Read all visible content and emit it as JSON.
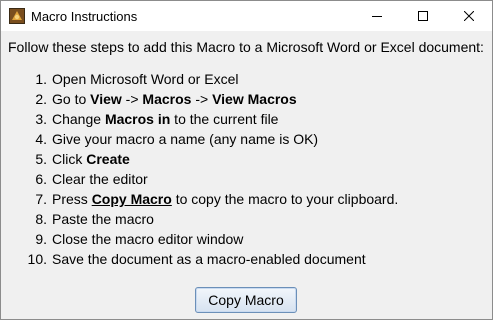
{
  "window": {
    "title": "Macro Instructions",
    "icon": "macro-app-icon",
    "controls": {
      "minimize": "minimize-icon",
      "maximize": "maximize-icon",
      "close": "close-icon"
    }
  },
  "intro": "Follow these steps to add this Macro to a Microsoft Word or Excel document:",
  "steps": [
    {
      "num": "1.",
      "parts": [
        {
          "t": "Open Microsoft Word or Excel"
        }
      ]
    },
    {
      "num": "2.",
      "parts": [
        {
          "t": "Go to "
        },
        {
          "t": "View",
          "b": true
        },
        {
          "t": " -> "
        },
        {
          "t": "Macros",
          "b": true
        },
        {
          "t": " -> "
        },
        {
          "t": "View Macros",
          "b": true
        }
      ]
    },
    {
      "num": "3.",
      "parts": [
        {
          "t": "Change "
        },
        {
          "t": "Macros in",
          "b": true
        },
        {
          "t": " to the current file"
        }
      ]
    },
    {
      "num": "4.",
      "parts": [
        {
          "t": "Give your macro a name (any name is OK)"
        }
      ]
    },
    {
      "num": "5.",
      "parts": [
        {
          "t": "Click "
        },
        {
          "t": "Create",
          "b": true
        }
      ]
    },
    {
      "num": "6.",
      "parts": [
        {
          "t": "Clear the editor"
        }
      ]
    },
    {
      "num": "7.",
      "parts": [
        {
          "t": "Press "
        },
        {
          "t": "Copy Macro",
          "b": true,
          "u": true
        },
        {
          "t": " to copy the macro to your clipboard."
        }
      ]
    },
    {
      "num": "8.",
      "parts": [
        {
          "t": "Paste the macro"
        }
      ]
    },
    {
      "num": "9.",
      "parts": [
        {
          "t": "Close the macro editor window"
        }
      ]
    },
    {
      "num": "10.",
      "parts": [
        {
          "t": "Save the document as a macro-enabled document"
        }
      ]
    }
  ],
  "copy_button": {
    "label": "Copy Macro"
  }
}
